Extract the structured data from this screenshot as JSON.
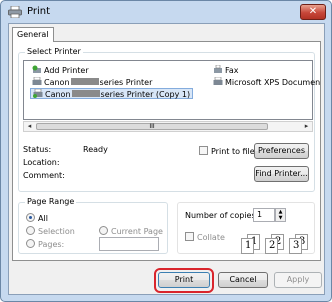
{
  "window": {
    "title": "Print",
    "close_symbol": "✕"
  },
  "tabs": [
    "General"
  ],
  "select_printer": {
    "label": "Select Printer",
    "printers": [
      {
        "name": "Add Printer",
        "icon": "add-printer-icon"
      },
      {
        "name_prefix": "Canon",
        "name_suffix": "series Printer",
        "icon": "printer-icon"
      },
      {
        "name_prefix": "Canon",
        "name_suffix": "series Printer (Copy 1)",
        "icon": "printer-icon",
        "selected": true
      },
      {
        "name": "Fax",
        "icon": "fax-icon"
      },
      {
        "name": "Microsoft XPS Documen",
        "icon": "printer-icon"
      }
    ],
    "scroll_thumb_glyph": "III"
  },
  "status": {
    "status_label": "Status:",
    "status_value": "Ready",
    "location_label": "Location:",
    "comment_label": "Comment:",
    "print_to_file": "Print to file",
    "print_to_file_checked": false,
    "preferences_button": "Preferences",
    "find_printer_button": "Find Printer..."
  },
  "page_range": {
    "label": "Page Range",
    "all": "All",
    "selection": "Selection",
    "current_page": "Current Page",
    "pages": "Pages:",
    "selected_option": "All"
  },
  "copies": {
    "label": "Number of copies:",
    "value": "1",
    "collate": "Collate",
    "collate_checked": false,
    "collate_pages": [
      "1",
      "1",
      "2",
      "2",
      "3",
      "3"
    ]
  },
  "footer": {
    "print_button": "Print",
    "cancel_button": "Cancel",
    "apply_button": "Apply"
  },
  "colors": {
    "highlight": "#d9252c",
    "window_frame": "#c6d9ef"
  }
}
